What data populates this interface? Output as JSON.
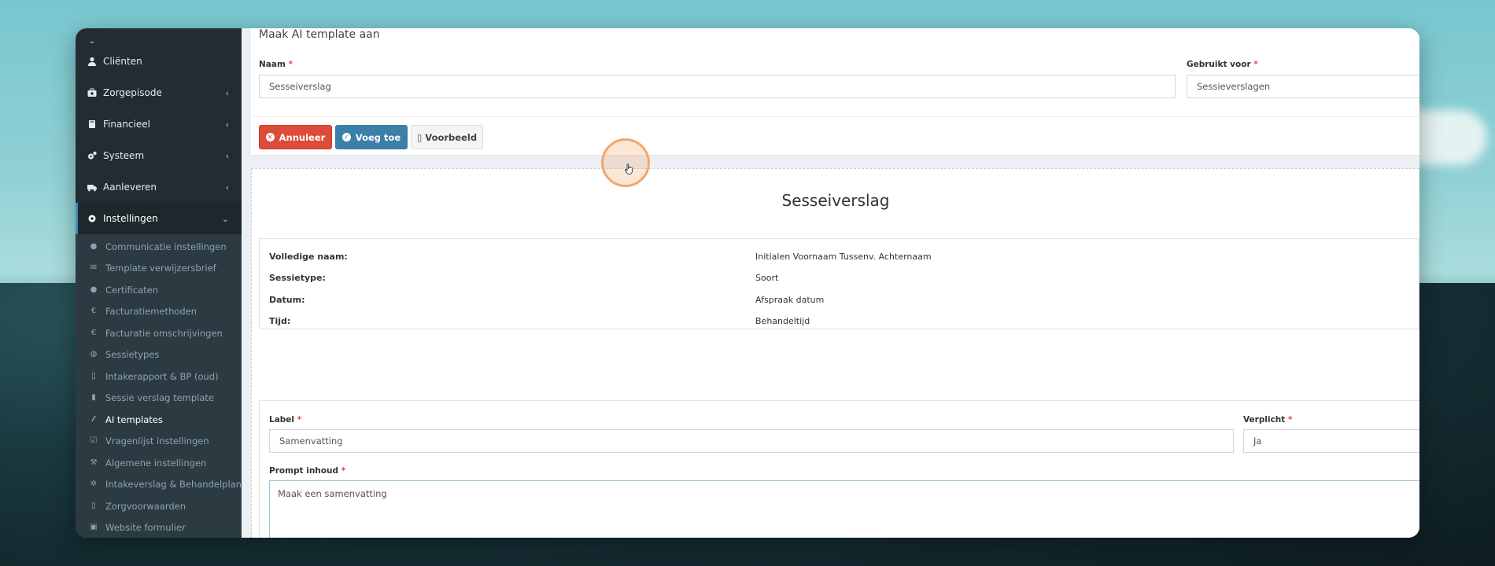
{
  "sidebar": {
    "partial_top": "Instellingen",
    "items": [
      {
        "label": "Cliënten",
        "icon": "user-icon",
        "has_caret": false
      },
      {
        "label": "Zorgepisode",
        "icon": "medkit-icon",
        "has_caret": true
      },
      {
        "label": "Financieel",
        "icon": "book-icon",
        "has_caret": true
      },
      {
        "label": "Systeem",
        "icon": "cogs-icon",
        "has_caret": true
      },
      {
        "label": "Aanleveren",
        "icon": "truck-icon",
        "has_caret": true
      },
      {
        "label": "Instellingen",
        "icon": "gear-icon",
        "has_caret": true,
        "expanded": true
      }
    ],
    "subitems": [
      {
        "label": "Communicatie instellingen",
        "icon": "comments-icon"
      },
      {
        "label": "Template verwijzersbrief",
        "icon": "envelope-icon"
      },
      {
        "label": "Certificaten",
        "icon": "circle-icon"
      },
      {
        "label": "Facturatiemethoden",
        "icon": "euro-icon"
      },
      {
        "label": "Facturatie omschrijvingen",
        "icon": "euro-icon"
      },
      {
        "label": "Sessietypes",
        "icon": "globe-icon"
      },
      {
        "label": "Intakerapport & BP (oud)",
        "icon": "file-icon"
      },
      {
        "label": "Sessie verslag template",
        "icon": "book-icon"
      },
      {
        "label": "AI templates",
        "icon": "magic-wand-icon",
        "current": true
      },
      {
        "label": "Vragenlijst instellingen",
        "icon": "check-square-icon"
      },
      {
        "label": "Algemene instellingen",
        "icon": "wrench-icon"
      },
      {
        "label": "Intakeverslag & Behandelplan",
        "icon": "gear-icon"
      },
      {
        "label": "Zorgvoorwaarden",
        "icon": "file-pdf-icon"
      },
      {
        "label": "Website formulier",
        "icon": "medkit-icon"
      }
    ]
  },
  "form": {
    "title": "Maak AI template aan",
    "name_label": "Naam",
    "name_value": "Sesseiverslag",
    "used_for_label": "Gebruikt voor",
    "used_for_value": "Sessieverslagen",
    "required_mark": "*"
  },
  "buttons": {
    "cancel": "Annuleer",
    "add": "Voeg toe",
    "preview": "Voorbeeld"
  },
  "preview": {
    "title": "Sesseiverslag",
    "rows": [
      {
        "key": "Volledige naam:",
        "value": "Initialen Voornaam Tussenv. Achternaam"
      },
      {
        "key": "Sessietype:",
        "value": "Soort"
      },
      {
        "key": "Datum:",
        "value": "Afspraak datum"
      },
      {
        "key": "Tijd:",
        "value": "Behandeltijd"
      }
    ]
  },
  "field": {
    "label_label": "Label",
    "label_value": "Samenvatting",
    "required_label": "Verplicht",
    "required_value": "Ja",
    "prompt_label": "Prompt inhoud",
    "prompt_value": "Maak een samenvatting"
  },
  "colors": {
    "sidebar_bg": "#222d32",
    "danger": "#dd4b39",
    "primary": "#3c7fa8",
    "cursor_highlight": "#f3a66a"
  }
}
